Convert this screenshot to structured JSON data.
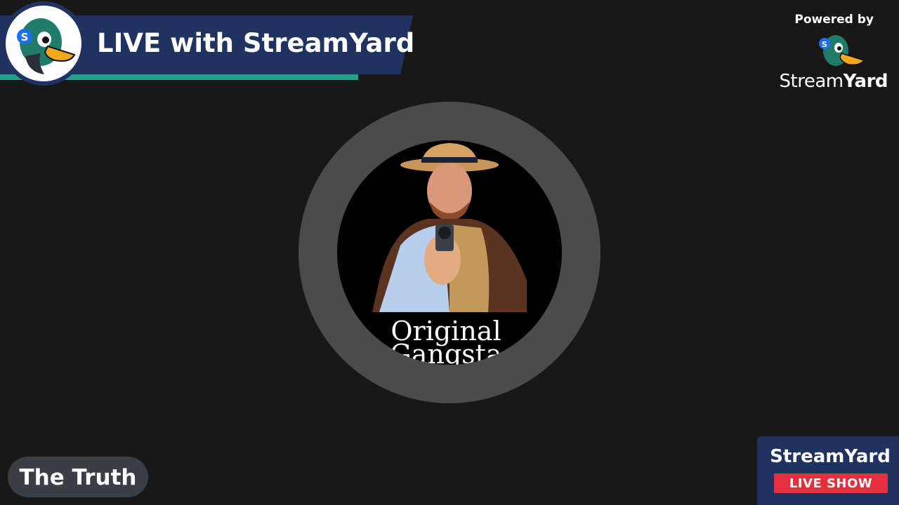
{
  "banner": {
    "title": "LIVE with StreamYard"
  },
  "powered_by": {
    "label": "Powered by",
    "brand_light": "Stream",
    "brand_bold": "Yard"
  },
  "avatar": {
    "caption_line1": "Original",
    "caption_line2": "Gangsta"
  },
  "name_tag": {
    "name": "The Truth"
  },
  "live_card": {
    "title": "StreamYard",
    "badge": "LIVE SHOW"
  },
  "colors": {
    "navy": "#203360",
    "teal": "#1fa28a",
    "red": "#e5303b",
    "background": "#181818"
  },
  "icons": [
    "streamyard-duck-logo",
    "streamyard-duck-logo-small"
  ]
}
